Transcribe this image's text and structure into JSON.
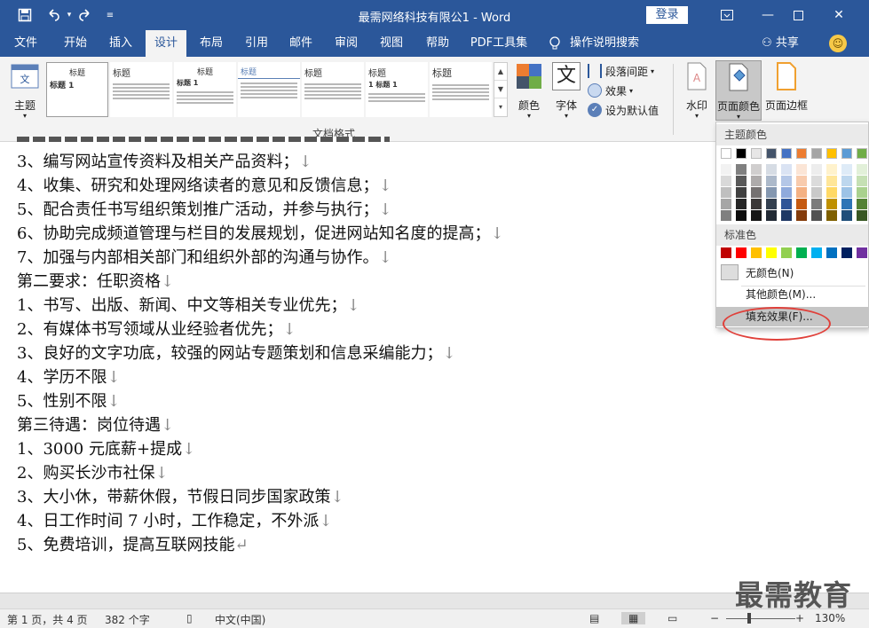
{
  "window": {
    "title": "最需网络科技有限公1 - Word",
    "login_label": "登录"
  },
  "tabs": [
    "文件",
    "开始",
    "插入",
    "设计",
    "布局",
    "引用",
    "邮件",
    "审阅",
    "视图",
    "帮助",
    "PDF工具集"
  ],
  "tell_me": "操作说明搜索",
  "share_label": "共享",
  "ribbon": {
    "theme_label": "主题",
    "style_gallery": [
      {
        "title": "标题",
        "heading": "标题 1"
      },
      {
        "title": "标题",
        "heading": ""
      },
      {
        "title": "标题",
        "heading": "标题 1"
      },
      {
        "title": "标题",
        "heading": ""
      },
      {
        "title": "标题",
        "heading": ""
      },
      {
        "title": "标题",
        "heading": "1 标题 1"
      },
      {
        "title": "标题",
        "heading": ""
      }
    ],
    "colors_label": "颜色",
    "fonts_label": "字体",
    "paragraph_spacing_label": "段落间距",
    "effects_label": "效果",
    "set_default_label": "设为默认值",
    "doc_format_group": "文档格式",
    "watermark_label": "水印",
    "page_color_label": "页面颜色",
    "page_border_label": "页面边框"
  },
  "document": {
    "lines": [
      "3、编写网站宣传资料及相关产品资料；",
      "4、收集、研究和处理网络读者的意见和反馈信息；",
      "5、配合责任书写组织策划推广活动，并参与执行；",
      "6、协助完成频道管理与栏目的发展规划，促进网站知名度的提高；",
      "7、加强与内部相关部门和组织外部的沟通与协作。",
      "第二要求：任职资格",
      "1、书写、出版、新闻、中文等相关专业优先；",
      "2、有媒体书写领域从业经验者优先；",
      "3、良好的文字功底，较强的网站专题策划和信息采编能力；",
      "4、学历不限",
      "5、性别不限",
      "第三待遇：岗位待遇",
      "1、3000 元底薪+提成",
      "2、购买长沙市社保",
      "3、大小休，带薪休假，节假日同步国家政策",
      "4、日工作时间 7 小时，工作稳定，不外派",
      "5、免费培训，提高互联网技能"
    ],
    "line_marks": [
      "↓",
      "↓",
      "↓",
      "↓",
      "↓",
      "↓",
      "↓",
      "↓",
      "↓",
      "↓",
      "↓",
      "↓",
      "↓",
      "↓",
      "↓",
      "↓",
      "↵"
    ]
  },
  "watermark_text": "最需教育",
  "status": {
    "page": "第 1 页，共 4 页",
    "words": "382 个字",
    "language": "中文(中国)",
    "zoom": "130%"
  },
  "page_color_menu": {
    "theme_colors_header": "主题颜色",
    "standard_colors_header": "标准色",
    "no_color": "无颜色(N)",
    "more_colors": "其他颜色(M)...",
    "fill_effects": "填充效果(F)...",
    "theme_top_row": [
      "#ffffff",
      "#000000",
      "#e7e6e6",
      "#44546a",
      "#4472c4",
      "#ed7d31",
      "#a5a5a5",
      "#ffc000",
      "#5b9bd5",
      "#70ad47"
    ],
    "theme_columns": [
      [
        "#f2f2f2",
        "#d9d9d9",
        "#bfbfbf",
        "#a6a6a6",
        "#808080"
      ],
      [
        "#808080",
        "#595959",
        "#404040",
        "#262626",
        "#0d0d0d"
      ],
      [
        "#d0cece",
        "#aeabab",
        "#757171",
        "#3b3838",
        "#161616"
      ],
      [
        "#d6dce4",
        "#acb9ca",
        "#8497b0",
        "#333f4f",
        "#222a35"
      ],
      [
        "#dae3f3",
        "#b4c7e7",
        "#8faadc",
        "#2f5597",
        "#1f3864"
      ],
      [
        "#fbe5d6",
        "#f8cbad",
        "#f4b183",
        "#c55a11",
        "#843c0c"
      ],
      [
        "#ededed",
        "#dbdbdb",
        "#c9c9c9",
        "#7b7b7b",
        "#525252"
      ],
      [
        "#fff2cc",
        "#ffe699",
        "#ffd966",
        "#bf9000",
        "#7f6000"
      ],
      [
        "#deebf7",
        "#bdd7ee",
        "#9dc3e6",
        "#2e75b6",
        "#1f4e79"
      ],
      [
        "#e2f0d9",
        "#c5e0b4",
        "#a9d18e",
        "#548235",
        "#385723"
      ]
    ],
    "standard": [
      "#c00000",
      "#ff0000",
      "#ffc000",
      "#ffff00",
      "#92d050",
      "#00b050",
      "#00b0f0",
      "#0070c0",
      "#002060",
      "#7030a0"
    ]
  },
  "colors": {
    "accent": "#2b579a",
    "annotation": "#e0403a"
  }
}
